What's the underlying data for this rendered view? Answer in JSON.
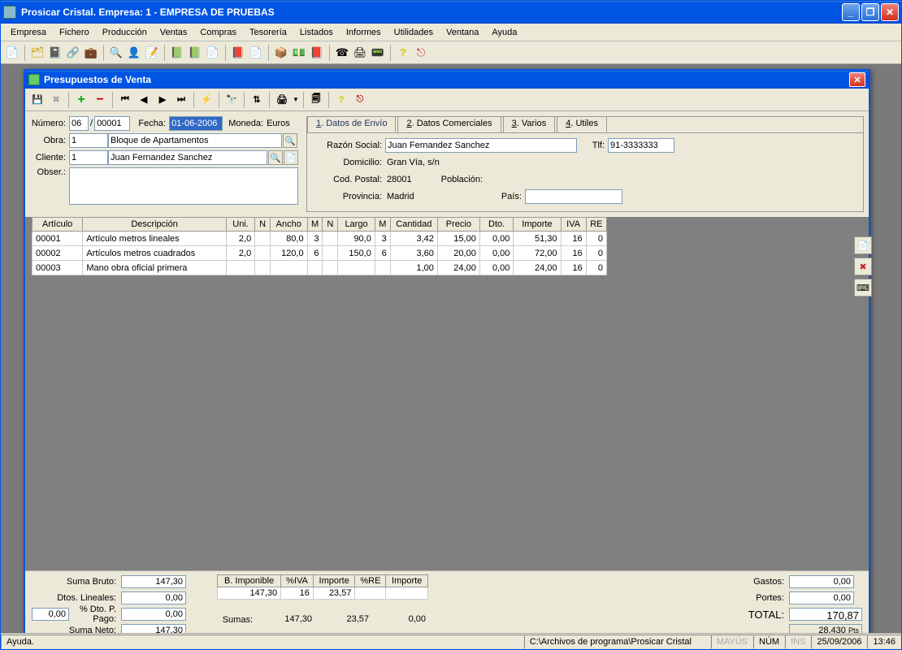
{
  "window": {
    "title": "Prosicar Cristal. Empresa: 1 - EMPRESA DE PRUEBAS"
  },
  "menu": [
    "Empresa",
    "Fichero",
    "Producción",
    "Ventas",
    "Compras",
    "Tesorería",
    "Listados",
    "Informes",
    "Utilidades",
    "Ventana",
    "Ayuda"
  ],
  "child": {
    "title": "Presupuestos de Venta"
  },
  "form": {
    "numero_label": "Número:",
    "numero_ser": "06",
    "numero_num": "00001",
    "fecha_label": "Fecha:",
    "fecha": "01-06-2006",
    "moneda_label": "Moneda:",
    "moneda": "Euros",
    "obra_label": "Obra:",
    "obra_code": "1",
    "obra_name": "Bloque de Apartamentos",
    "cliente_label": "Cliente:",
    "cliente_code": "1",
    "cliente_name": "Juan Fernandez Sanchez",
    "obser_label": "Obser.:",
    "obser": ""
  },
  "tabs": {
    "items": [
      {
        "accel": "1",
        "label": ". Datos de Envío"
      },
      {
        "accel": "2",
        "label": ". Datos Comerciales"
      },
      {
        "accel": "3",
        "label": ". Varios"
      },
      {
        "accel": "4",
        "label": ". Utiles"
      }
    ],
    "active": 0
  },
  "envio": {
    "razon_label": "Razón Social:",
    "razon": "Juan Fernandez Sanchez",
    "tlf_label": "Tlf:",
    "tlf": "91-3333333",
    "domicilio_label": "Domicilio:",
    "domicilio": "Gran Vía, s/n",
    "cp_label": "Cod. Postal:",
    "cp": "28001",
    "poblacion_label": "Población:",
    "poblacion": "",
    "provincia_label": "Provincia:",
    "provincia": "Madrid",
    "pais_label": "País:",
    "pais": ""
  },
  "grid": {
    "headers": [
      "Artículo",
      "Descripción",
      "Uni.",
      "N",
      "Ancho",
      "M",
      "N",
      "Largo",
      "M",
      "Cantidad",
      "Precio",
      "Dto.",
      "Importe",
      "IVA",
      "RE"
    ],
    "rows": [
      {
        "art": "00001",
        "desc": "Artículo metros lineales",
        "uni": "2,0",
        "n1": "",
        "ancho": "80,0",
        "m1": "3",
        "n2": "",
        "largo": "90,0",
        "m2": "3",
        "cant": "3,42",
        "precio": "15,00",
        "dto": "0,00",
        "imp": "51,30",
        "iva": "16",
        "re": "0"
      },
      {
        "art": "00002",
        "desc": "Artículos metros cuadrados",
        "uni": "2,0",
        "n1": "",
        "ancho": "120,0",
        "m1": "6",
        "n2": "",
        "largo": "150,0",
        "m2": "6",
        "cant": "3,60",
        "precio": "20,00",
        "dto": "0,00",
        "imp": "72,00",
        "iva": "16",
        "re": "0"
      },
      {
        "art": "00003",
        "desc": "Mano obra oficial primera",
        "uni": "",
        "n1": "",
        "ancho": "",
        "m1": "",
        "n2": "",
        "largo": "",
        "m2": "",
        "cant": "1,00",
        "precio": "24,00",
        "dto": "0,00",
        "imp": "24,00",
        "iva": "16",
        "re": "0"
      }
    ]
  },
  "totals": {
    "left": {
      "bruto_label": "Suma Bruto:",
      "bruto": "147,30",
      "dlin_label": "Dtos. Lineales:",
      "dlin": "0,00",
      "pp_pct": "0,00",
      "pp_label": "% Dto. P. Pago:",
      "pp": "0,00",
      "neto_label": "Suma Neto:",
      "neto": "147,30"
    },
    "center": {
      "headers": [
        "B. Imponible",
        "%IVA",
        "Importe",
        "%RE",
        "Importe"
      ],
      "row": [
        "147,30",
        "16",
        "23,57",
        "",
        ""
      ],
      "sumas_label": "Sumas:",
      "sum_bi": "147,30",
      "sum_iva": "23,57",
      "sum_re": "0,00"
    },
    "right": {
      "gastos_label": "Gastos:",
      "gastos": "0,00",
      "portes_label": "Portes:",
      "portes": "0,00",
      "total_label": "TOTAL:",
      "total": "170,87",
      "pts": "28.430",
      "pts_suffix": "Pts"
    }
  },
  "status": {
    "help": "Ayuda.",
    "path": "C:\\Archivos de programa\\Prosicar Cristal",
    "mayus": "MAYÚS",
    "num": "NÚM",
    "ins": "INS",
    "date": "25/09/2006",
    "time": "13:46"
  }
}
